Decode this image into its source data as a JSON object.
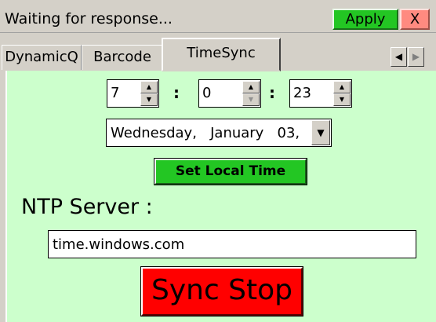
{
  "window": {
    "status_text": "Waiting for response...",
    "apply_label": "Apply",
    "close_label": "X"
  },
  "tabs": [
    {
      "label": "DynamicQ"
    },
    {
      "label": "Barcode"
    },
    {
      "label": "TimeSync",
      "active": true
    }
  ],
  "tab_scroll": {
    "left": "◀",
    "right": "▶"
  },
  "time": {
    "hour": "7",
    "minute": "0",
    "second": "23",
    "separator": ":"
  },
  "date": {
    "value": "Wednesday,   January   03,"
  },
  "buttons": {
    "set_local_time": "Set Local Time",
    "sync_stop": "Sync Stop"
  },
  "ntp": {
    "label": "NTP Server :",
    "server": "time.windows.com"
  },
  "colors": {
    "panel_bg": "#ccffcc",
    "apply_bg": "#23c623",
    "close_bg": "#ff8a80",
    "sync_bg": "#ff0000"
  }
}
